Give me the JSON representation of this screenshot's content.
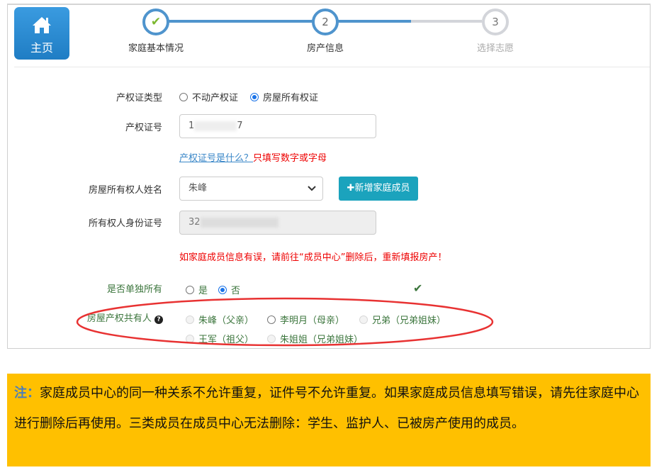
{
  "home": {
    "label": "主页",
    "icon": "home-icon"
  },
  "steps": [
    {
      "num": "✔",
      "label": "家庭基本情况",
      "state": "done"
    },
    {
      "num": "2",
      "label": "房产信息",
      "state": "active"
    },
    {
      "num": "3",
      "label": "选择志愿",
      "state": "pending"
    }
  ],
  "colors": {
    "accent": "#4f94cd",
    "button": "#1ba3bd",
    "note_bg": "#ffc000",
    "error": "#e00000"
  },
  "form": {
    "cert_type": {
      "label": "产权证类型",
      "options": [
        "不动产权证",
        "房屋所有权证"
      ],
      "selected": "房屋所有权证"
    },
    "cert_no": {
      "label": "产权证号",
      "value_start": "1",
      "value_end": "7",
      "help_link": "产权证号是什么？",
      "help_hint": "只填写数字或字母"
    },
    "owner_name": {
      "label": "房屋所有权人姓名",
      "value": "朱峰",
      "add_button": "✚新增家庭成员"
    },
    "owner_id": {
      "label": "所有权人身份证号",
      "value_start": "32"
    },
    "error_msg": "如家庭成员信息有误，请前往“成员中心”删除后，重新填报房产！",
    "sole_owner": {
      "label": "是否单独所有",
      "options": [
        "是",
        "否"
      ],
      "selected": "否"
    },
    "co_owners": {
      "label": "房屋产权共有人",
      "options": [
        {
          "label": "朱峰（父亲）",
          "disabled": true
        },
        {
          "label": "李明月（母亲）",
          "disabled": false
        },
        {
          "label": "兄弟（兄弟姐妹）",
          "disabled": true
        },
        {
          "label": "王军（祖父）",
          "disabled": true
        },
        {
          "label": "朱姐姐（兄弟姐妹）",
          "disabled": true
        }
      ]
    }
  },
  "note": {
    "key": "注：",
    "text": "家庭成员中心的同一种关系不允许重复，证件号不允许重复。如果家庭成员信息填写错误，请先往家庭中心进行删除后再使用。三类成员在成员中心无法删除：学生、监护人、已被房产使用的成员。"
  }
}
